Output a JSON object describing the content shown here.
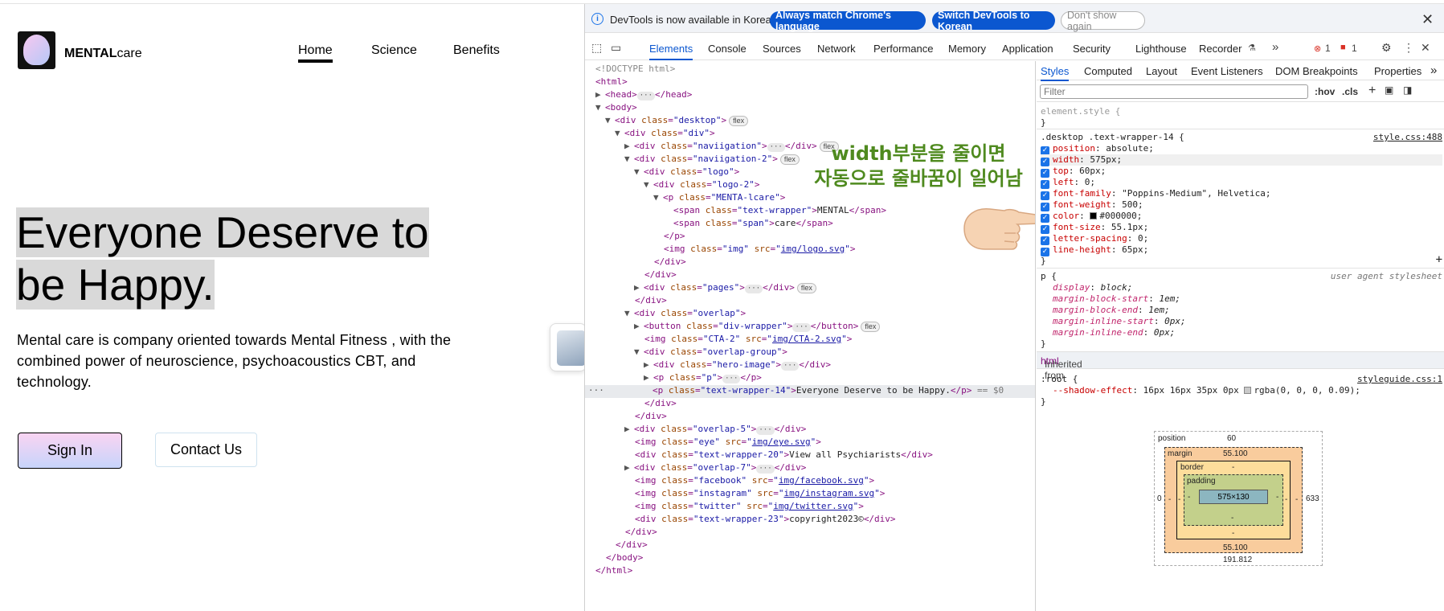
{
  "site": {
    "brand_bold": "MENTAL",
    "brand_rest": "care",
    "nav": [
      "Home",
      "Science",
      "Benefits"
    ],
    "hero_line1": "Everyone Deserve to",
    "hero_line2": "be Happy.",
    "description": "Mental care is company oriented towards Mental Fitness , with the combined power of neuroscience, psychoacoustics CBT, and technology.",
    "sign_in": "Sign In",
    "contact": "Contact Us"
  },
  "devtools": {
    "infobar": {
      "message": "DevTools is now available in Korean!",
      "btn_match": "Always match Chrome's language",
      "btn_switch": "Switch DevTools to Korean",
      "btn_dismiss": "Don't show again"
    },
    "tabs": [
      "Elements",
      "Console",
      "Sources",
      "Network",
      "Performance",
      "Memory",
      "Application",
      "Security",
      "Lighthouse",
      "Recorder"
    ],
    "error_count": "1",
    "issue_count": "1",
    "style_tabs": [
      "Styles",
      "Computed",
      "Layout",
      "Event Listeners",
      "DOM Breakpoints",
      "Properties"
    ],
    "filter_placeholder": "Filter",
    "hov": ":hov",
    "cls": ".cls",
    "annotation_line1": "width부분을 줄이면",
    "annotation_line2": "자동으로 줄바꿈이 일어남",
    "inherited_label": "Inherited from",
    "inherited_tag": "html",
    "user_agent": "user agent stylesheet",
    "box": {
      "position_label": "position",
      "position_top": "60",
      "position_left": "0",
      "position_right": "633",
      "position_bottom": "191.812",
      "margin_label": "margin",
      "margin_top": "55.100",
      "margin_bottom": "55.100",
      "border_label": "border",
      "padding_label": "padding",
      "dash": "-",
      "content": "575×130"
    }
  },
  "colors": {
    "accent": "#0b57d0",
    "annotation": "#4f8a1f",
    "tag": "#881280",
    "attr": "#994500",
    "value": "#1a1aa6"
  }
}
